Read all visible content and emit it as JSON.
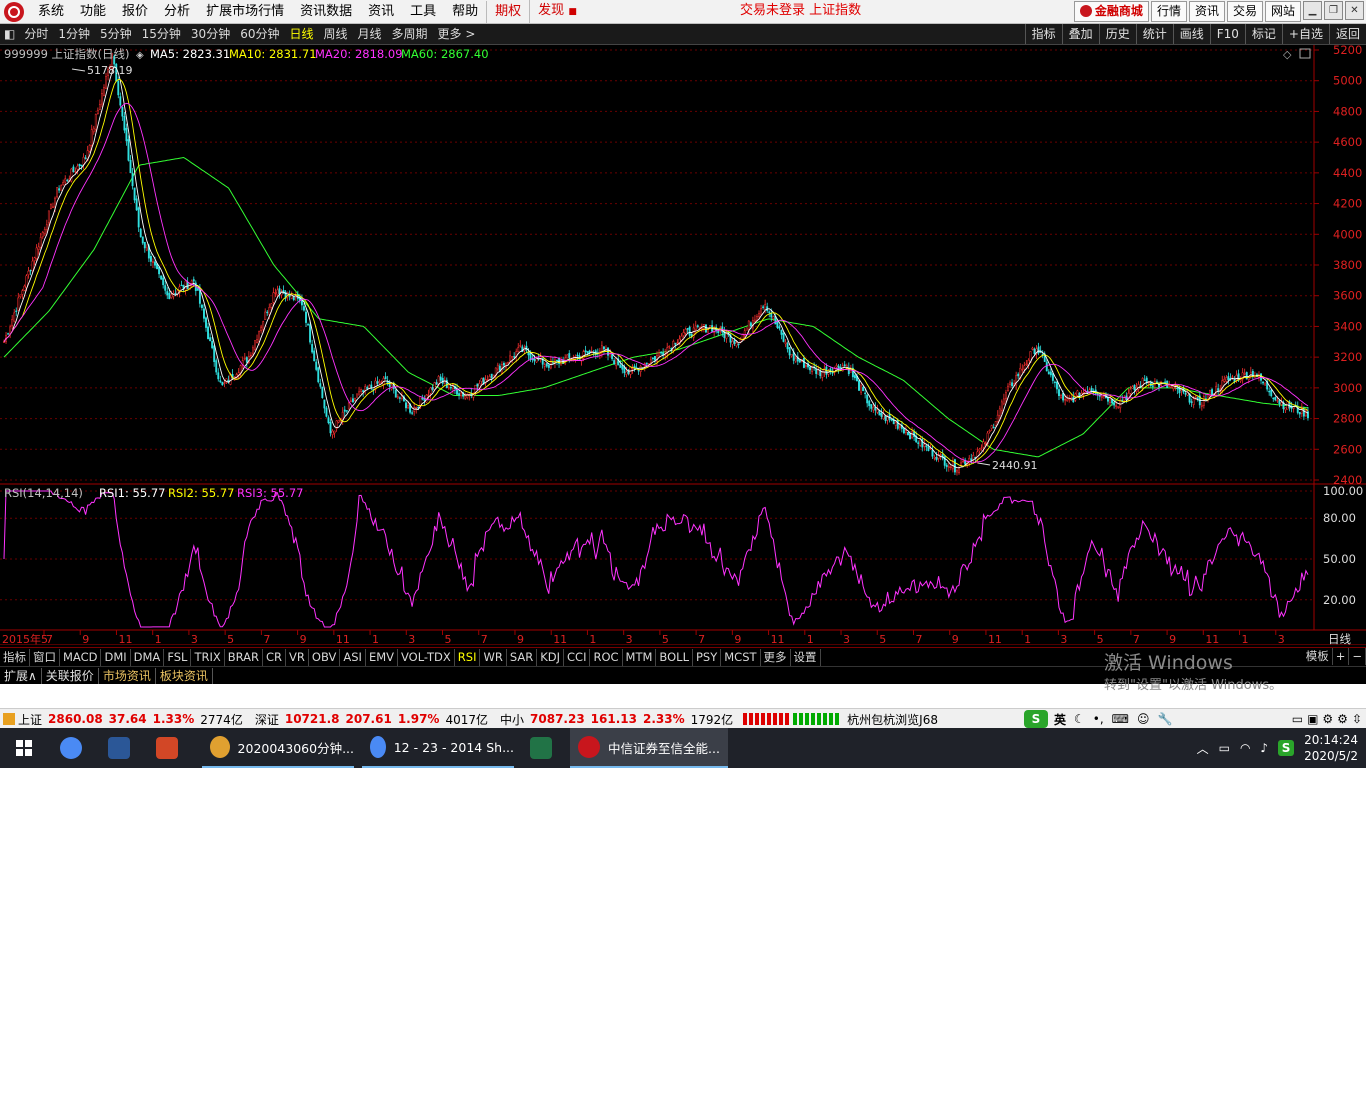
{
  "menu": {
    "items": [
      "系统",
      "功能",
      "报价",
      "分析",
      "扩展市场行情",
      "资讯数据",
      "资讯",
      "工具",
      "帮助"
    ],
    "special": [
      {
        "label": "期权",
        "dot": false
      },
      {
        "label": "发现",
        "dot": true
      }
    ],
    "center_status": "交易未登录  上证指数",
    "right_buttons": [
      "金融商城",
      "行情",
      "资讯",
      "交易",
      "网站"
    ]
  },
  "periods": {
    "items": [
      "分时",
      "1分钟",
      "5分钟",
      "15分钟",
      "30分钟",
      "60分钟",
      "日线",
      "周线",
      "月线",
      "多周期",
      "更多 >"
    ],
    "active": "日线",
    "tools": [
      "指标",
      "叠加",
      "历史",
      "统计",
      "画线",
      "F10",
      "标记",
      "+自选",
      "返回"
    ]
  },
  "price_chart": {
    "code_title": "999999 上证指数(日线)",
    "ma": [
      {
        "label": "MA5: 2823.31",
        "color": "#ffffff"
      },
      {
        "label": "MA10: 2831.71",
        "color": "#ffff00"
      },
      {
        "label": "MA20: 2818.09",
        "color": "#ff33ff"
      },
      {
        "label": "MA60: 2867.40",
        "color": "#33ff33"
      }
    ],
    "high_label": "5178.19",
    "low_label": "2440.91",
    "yticks": [
      "5200",
      "5000",
      "4800",
      "4600",
      "4400",
      "4200",
      "4000",
      "3800",
      "3600",
      "3400",
      "3200",
      "3000",
      "2800",
      "2600",
      "2400"
    ]
  },
  "rsi_chart": {
    "title": "RSI(14,14,14)",
    "values": [
      {
        "label": "RSI1: 55.77",
        "color": "#ffffff"
      },
      {
        "label": "RSI2: 55.77",
        "color": "#ffff00"
      },
      {
        "label": "RSI3: 55.77",
        "color": "#ff33ff"
      }
    ],
    "yticks": [
      "100.00",
      "80.00",
      "50.00",
      "20.00"
    ]
  },
  "xaxis": {
    "labels": [
      "2015年5",
      "7",
      "9",
      "11",
      "1",
      "3",
      "5",
      "7",
      "9",
      "11",
      "1",
      "3",
      "5",
      "7",
      "9",
      "11",
      "1",
      "3",
      "5",
      "7",
      "9",
      "11",
      "1",
      "3",
      "5",
      "7",
      "9",
      "11",
      "1",
      "3",
      "5",
      "7",
      "9",
      "11",
      "1",
      "3"
    ],
    "period": "日线"
  },
  "chart_data": {
    "type": "line",
    "title": "999999 上证指数(日线)",
    "ylim": [
      2400,
      5200
    ],
    "series": [
      {
        "name": "上证指数",
        "values": [
          3300,
          3800,
          4300,
          4500,
          5178,
          4000,
          3600,
          3700,
          3000,
          3200,
          3650,
          3550,
          2700,
          2950,
          3050,
          2850,
          3050,
          2950,
          3100,
          3250,
          3150,
          3200,
          3250,
          3100,
          3200,
          3350,
          3400,
          3300,
          3560,
          3200,
          3100,
          3150,
          2850,
          2750,
          2600,
          2480,
          2600,
          3000,
          3270,
          2900,
          3000,
          2900,
          3050,
          3000,
          2900,
          3050,
          3100,
          2900,
          2830
        ]
      },
      {
        "name": "MA60",
        "values": [
          3200,
          3500,
          3900,
          4450,
          4500,
          4300,
          3800,
          3450,
          3400,
          3100,
          2950,
          2950,
          3000,
          3100,
          3200,
          3250,
          3350,
          3450,
          3400,
          3200,
          3050,
          2800,
          2600,
          2550,
          2700,
          3000,
          3000,
          2950,
          2900,
          2870
        ]
      }
    ]
  },
  "indicators": {
    "items": [
      "指标",
      "窗口",
      "MACD",
      "DMI",
      "DMA",
      "FSL",
      "TRIX",
      "BRAR",
      "CR",
      "VR",
      "OBV",
      "ASI",
      "EMV",
      "VOL-TDX",
      "RSI",
      "WR",
      "SAR",
      "KDJ",
      "CCI",
      "ROC",
      "MTM",
      "BOLL",
      "PSY",
      "MCST",
      "更多",
      "设置"
    ],
    "active": "RSI",
    "right": [
      "模板",
      "+",
      "−"
    ]
  },
  "info_tabs": [
    "扩展∧",
    "关联报价",
    "市场资讯",
    "板块资讯"
  ],
  "watermark": {
    "line1": "激活 Windows",
    "line2": "转到\"设置\"以激活 Windows。"
  },
  "status": {
    "sh": {
      "name": "上证",
      "price": "2860.08",
      "change": "37.64",
      "pct": "1.33%",
      "amount": "2774亿"
    },
    "sz": {
      "name": "深证",
      "price": "10721.8",
      "change": "207.61",
      "pct": "1.97%",
      "amount": "4017亿"
    },
    "zx": {
      "name": "中小",
      "price": "7087.23",
      "change": "161.13",
      "pct": "2.33%",
      "amount": "1792亿"
    },
    "server": "杭州包杭浏览J68",
    "ime": "英"
  },
  "taskbar": {
    "apps": [
      {
        "label": "",
        "icon": "chrome-icon",
        "color": "#4a8af4"
      },
      {
        "label": "",
        "icon": "word-icon",
        "color": "#2b5797"
      },
      {
        "label": "",
        "icon": "powerpoint-icon",
        "color": "#d24726"
      },
      {
        "label": "2020043060分钟...",
        "icon": "paint-icon",
        "color": "#e0a030"
      },
      {
        "label": "12 - 23 - 2014 Sh...",
        "icon": "chrome-icon",
        "color": "#4a8af4"
      },
      {
        "label": "",
        "icon": "excel-icon",
        "color": "#217346"
      },
      {
        "label": "中信证券至信全能...",
        "icon": "citic-icon",
        "color": "#c8161d"
      }
    ],
    "time": "20:14:24",
    "date": "2020/5/2"
  }
}
